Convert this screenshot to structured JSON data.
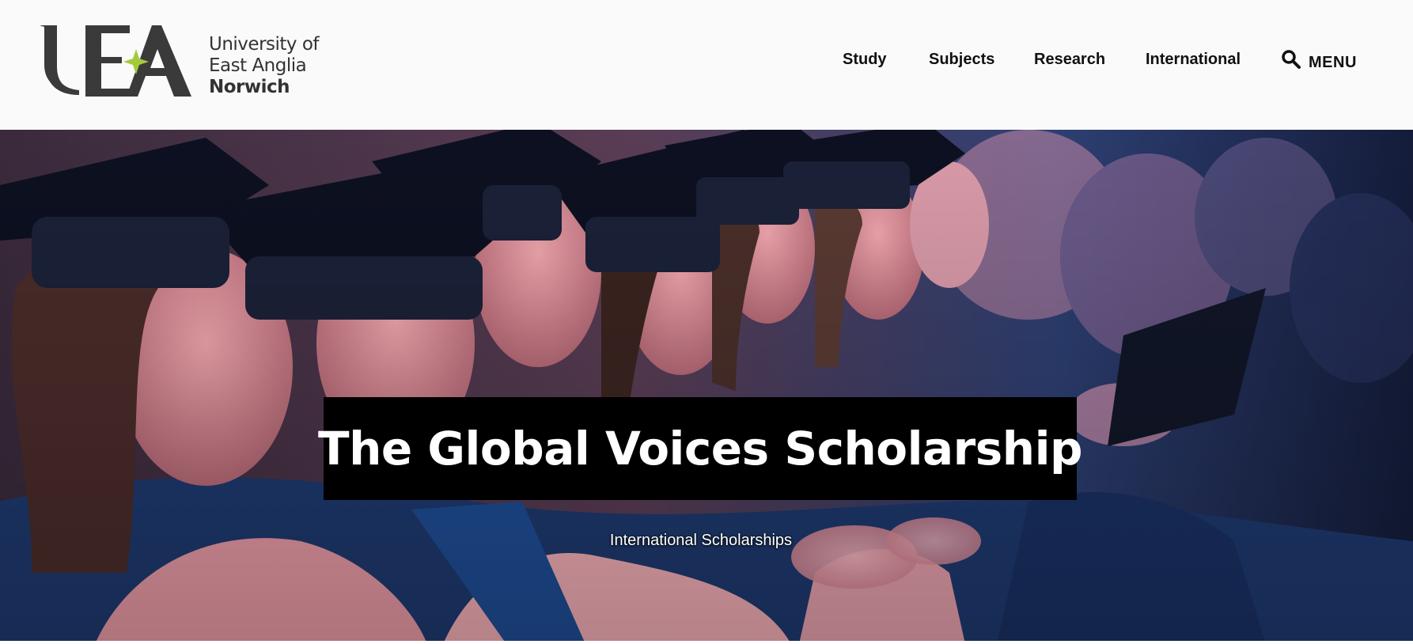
{
  "brand": {
    "line1": "University of",
    "line2": "East Anglia",
    "line3": "Norwich",
    "mark": "UEA",
    "accent_color": "#a4c93a",
    "text_color": "#333333"
  },
  "nav": {
    "items": [
      {
        "label": "Study"
      },
      {
        "label": "Subjects"
      },
      {
        "label": "Research"
      },
      {
        "label": "International"
      }
    ],
    "search_icon": "search-icon",
    "menu_label": "MENU"
  },
  "hero": {
    "title": "The Global Voices Scholarship",
    "subtitle": "International Scholarships",
    "image_subject": "graduates in caps and gowns seated in a row"
  }
}
